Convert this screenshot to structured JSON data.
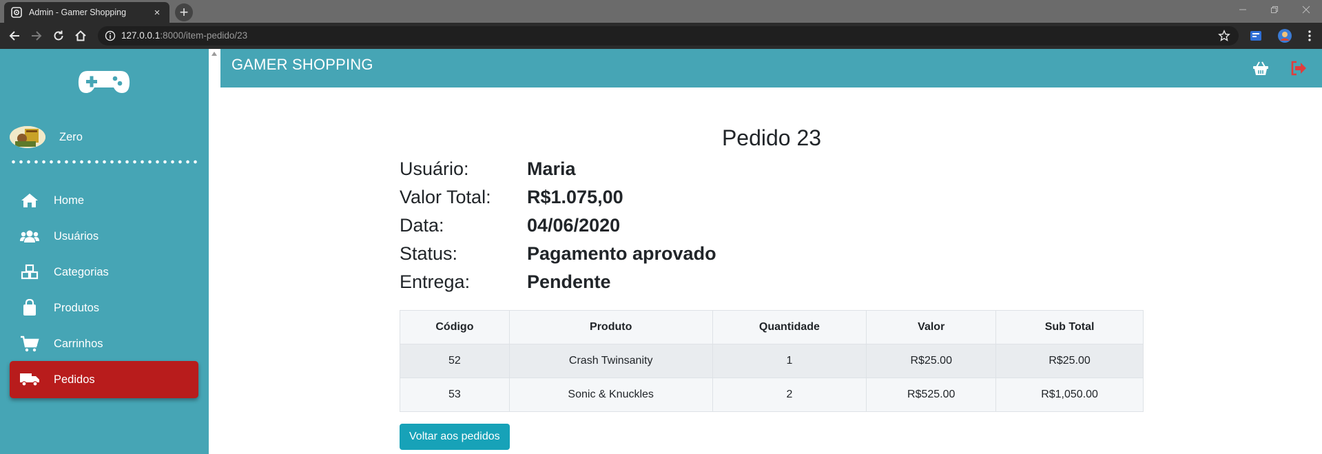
{
  "browser": {
    "tab_title": "Admin - Gamer Shopping",
    "tab_close": "×",
    "new_tab": "+",
    "url_host": "127.0.0.1",
    "url_rest": ":8000/item-pedido/23"
  },
  "sidebar": {
    "user_name": "Zero",
    "items": [
      {
        "label": "Home",
        "icon": "home-icon"
      },
      {
        "label": "Usuários",
        "icon": "users-icon"
      },
      {
        "label": "Categorias",
        "icon": "cubes-icon"
      },
      {
        "label": "Produtos",
        "icon": "shopping-bag-icon"
      },
      {
        "label": "Carrinhos",
        "icon": "cart-icon"
      },
      {
        "label": "Pedidos",
        "icon": "truck-icon",
        "active": true
      }
    ]
  },
  "header": {
    "brand": "GAMER SHOPPING"
  },
  "order": {
    "title": "Pedido 23",
    "fields": [
      {
        "label": "Usuário:",
        "value": "Maria"
      },
      {
        "label": "Valor Total:",
        "value": "R$1.075,00"
      },
      {
        "label": "Data:",
        "value": "04/06/2020"
      },
      {
        "label": "Status:",
        "value": "Pagamento aprovado"
      },
      {
        "label": "Entrega:",
        "value": "Pendente"
      }
    ]
  },
  "table": {
    "headers": [
      "Código",
      "Produto",
      "Quantidade",
      "Valor",
      "Sub Total"
    ],
    "rows": [
      [
        "52",
        "Crash Twinsanity",
        "1",
        "R$25.00",
        "R$25.00"
      ],
      [
        "53",
        "Sonic & Knuckles",
        "2",
        "R$525.00",
        "R$1,050.00"
      ]
    ]
  },
  "back_button": "Voltar aos pedidos",
  "colors": {
    "sidebar": "#46a5b5",
    "active_item": "#b81c1c",
    "button": "#17a2b8",
    "logout": "#e03c3c"
  }
}
